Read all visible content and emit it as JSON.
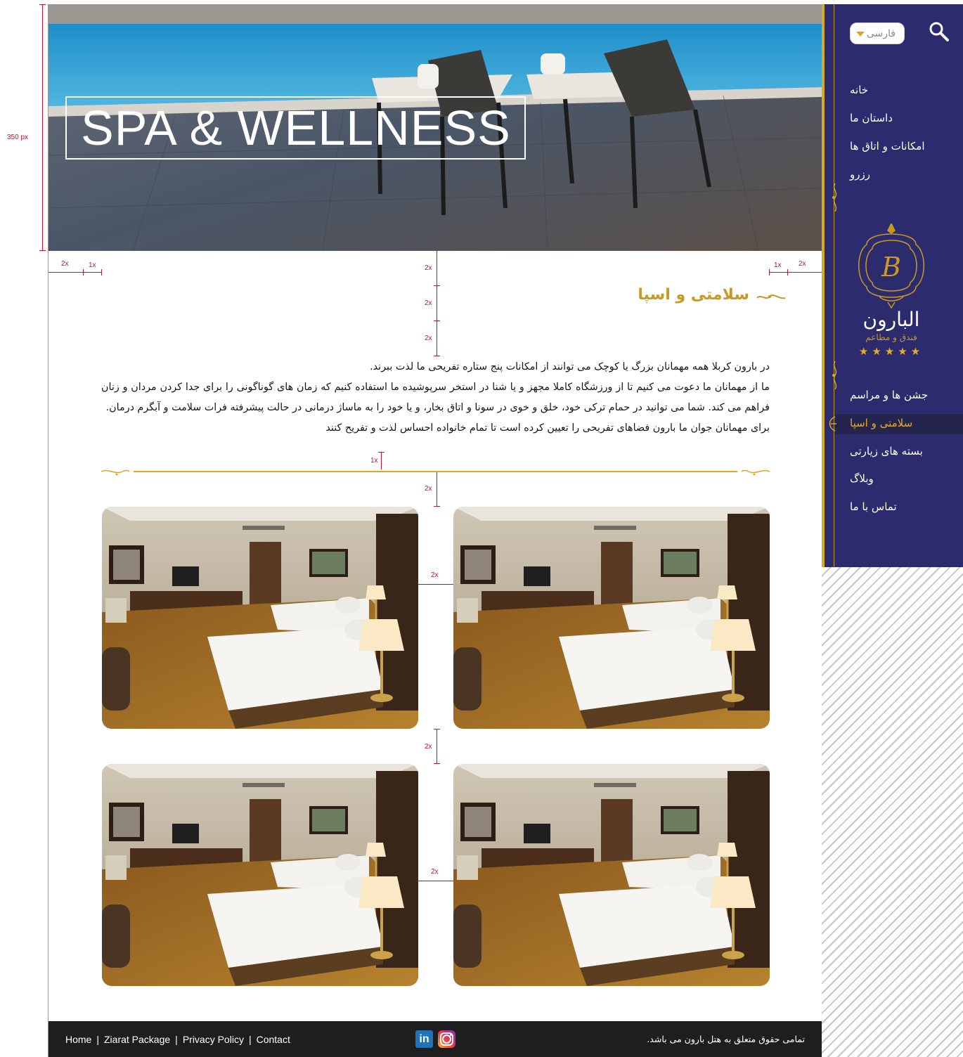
{
  "hero": {
    "title": "SPA & WELLNESS",
    "height_label": "350 px"
  },
  "sidebar": {
    "language": "فارسی",
    "nav_top": [
      {
        "label": "خانه"
      },
      {
        "label": "داستان ما"
      },
      {
        "label": "امکانات و اتاق ها"
      },
      {
        "label": "رزرو"
      }
    ],
    "logo_name": "البارون",
    "logo_sub": "فندق و مطاعم",
    "logo_letter": "B",
    "logo_stars": "★★★★★",
    "nav_bottom": [
      {
        "label": "جشن ها  و مراسم"
      },
      {
        "label": "سلامتی و اسپا"
      },
      {
        "label": "بسته های زیارتی"
      },
      {
        "label": "وبلاگ"
      },
      {
        "label": "تماس با ما"
      }
    ],
    "active_index": 1
  },
  "main": {
    "heading": "سلامتی و اسپا",
    "paragraphs": [
      "در بارون کربلا همه مهمانان بزرگ یا کوچک می توانند از امکانات پنج ستاره تفریحی ما لذت ببرند.",
      "ما از مهمانان ما دعوت می کنیم تا از ورزشگاه کاملا مجهز و یا شنا در استخر سرپوشیده ما استفاده کنیم که زمان های گوناگونی را برای جدا کردن مردان و زنان فراهم می کند. شما می توانید در حمام ترکی خود، خلق و خوی در سونا و اتاق بخار، و یا خود را به ماساژ درمانی در حالت پیشرفته فرات سلامت و آبگرم درمان.",
      "برای مهمانان جوان ما بارون فضاهای تفریحی را تعیین کرده است تا تمام خانواده احساس لذت و تفریح کنند"
    ],
    "gallery_count": 4
  },
  "spec_labels": {
    "two_x": "2x",
    "one_x": "1x"
  },
  "footer": {
    "links": [
      "Home",
      "Ziarat Package",
      "Privacy Policy",
      "Contact"
    ],
    "separator": "|",
    "linkedin": "in",
    "copyright": "تمامی حقوق متعلق به هتل بارون می باشد."
  },
  "colors": {
    "sidebar_bg": "#2b2b6e",
    "gold": "#d9a826",
    "heading_gold": "#c99a22",
    "footer_bg": "#1e1e1e",
    "spec_red": "#c8102e"
  }
}
